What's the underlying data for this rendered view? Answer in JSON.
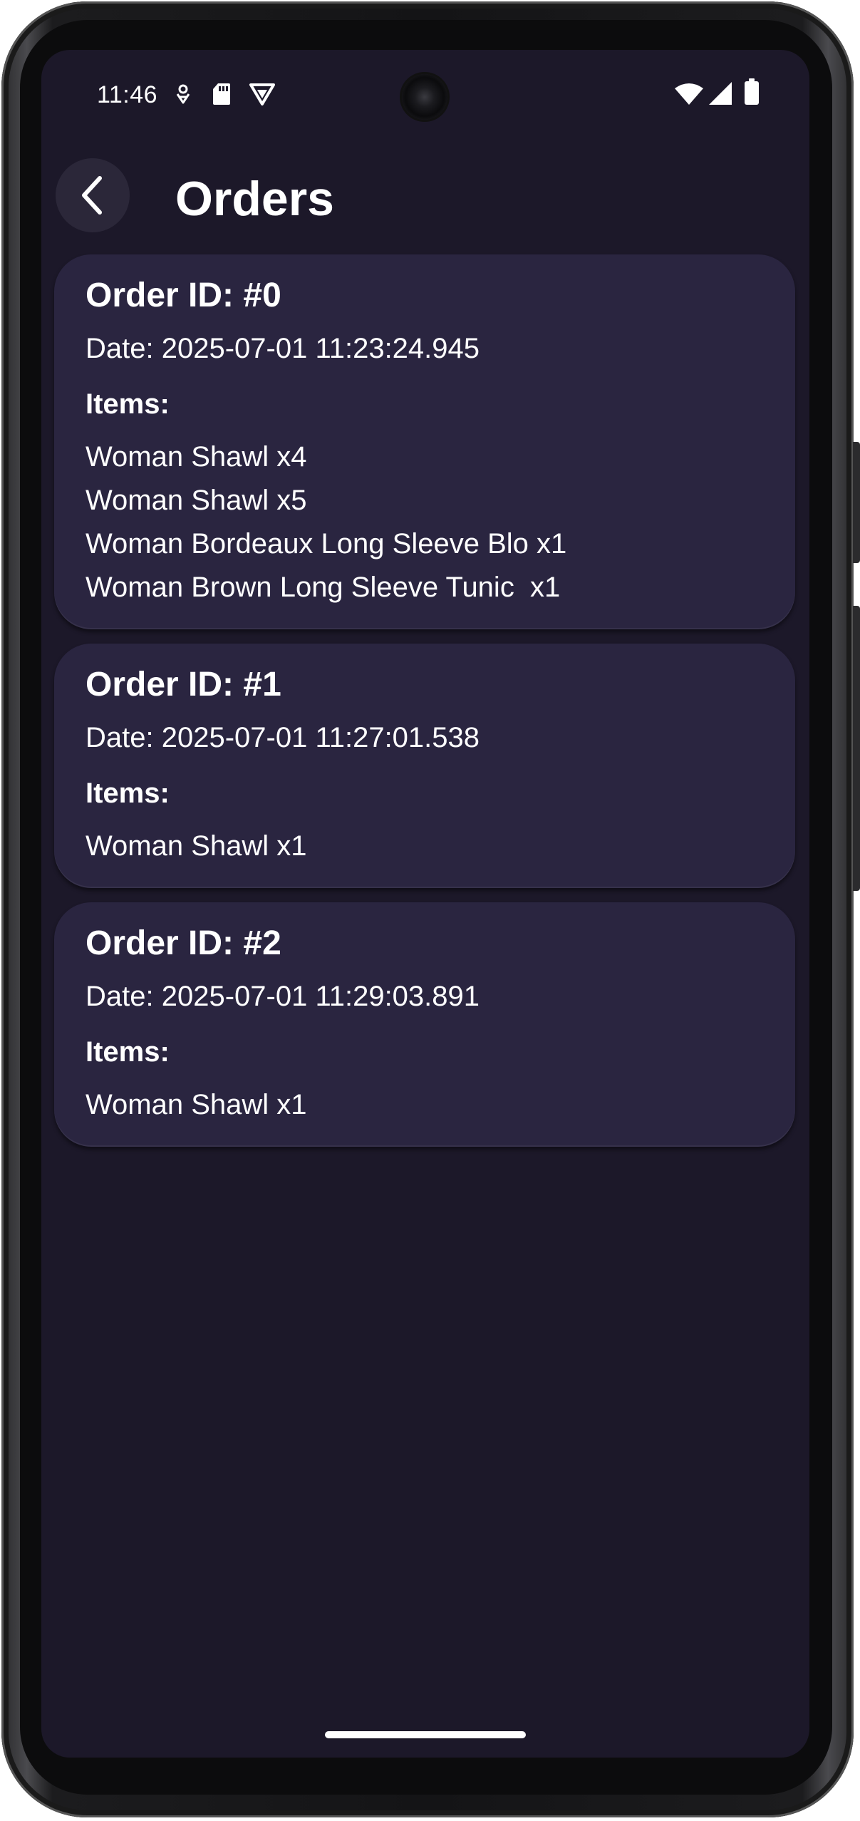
{
  "status_bar": {
    "time": "11:46",
    "left_icons": [
      "location-icon",
      "sd-card-icon",
      "vpn-shield-icon"
    ],
    "right_icons": [
      "wifi-icon",
      "cellular-signal-icon",
      "battery-icon"
    ]
  },
  "header": {
    "title": "Orders",
    "back_icon": "back-arrow-icon"
  },
  "orders": [
    {
      "id_label": "Order ID: #0",
      "date_label": "Date: 2025-07-01 11:23:24.945",
      "items_label": "Items:",
      "items": [
        "Woman Shawl x4",
        "Woman Shawl x5",
        "Woman Bordeaux Long Sleeve Blo x1",
        "Woman Brown Long Sleeve Tunic  x1"
      ]
    },
    {
      "id_label": "Order ID: #1",
      "date_label": "Date: 2025-07-01 11:27:01.538",
      "items_label": "Items:",
      "items": [
        "Woman Shawl x1"
      ]
    },
    {
      "id_label": "Order ID: #2",
      "date_label": "Date: 2025-07-01 11:29:03.891",
      "items_label": "Items:",
      "items": [
        "Woman Shawl x1"
      ]
    }
  ],
  "colors": {
    "background": "#1c1829",
    "card": "#2a2540",
    "back_button": "#2b2739",
    "text": "#ffffff"
  }
}
